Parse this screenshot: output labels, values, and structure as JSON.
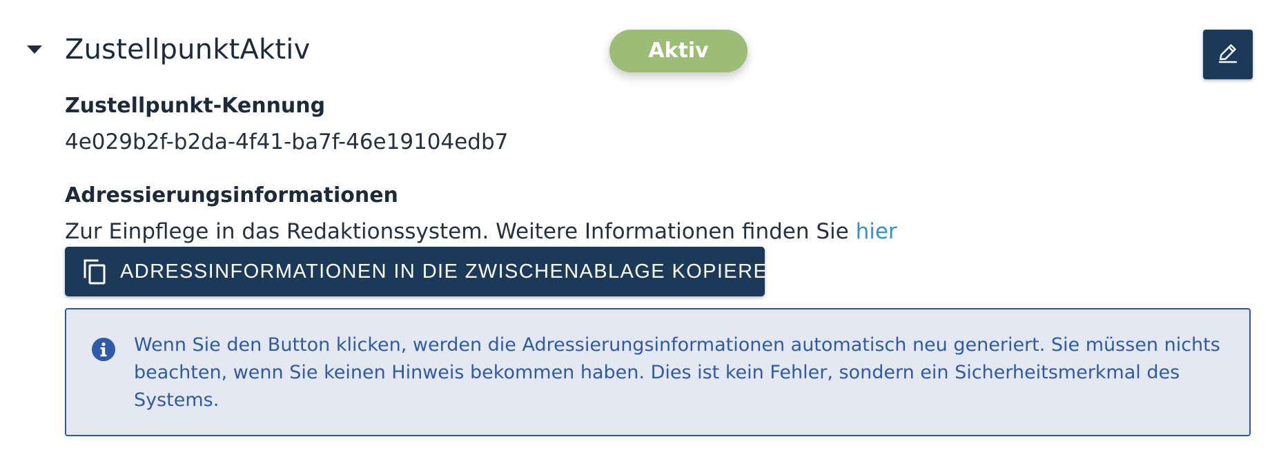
{
  "header": {
    "title": "ZustellpunktAktiv",
    "status": "Aktiv",
    "status_color": "#9bbd75",
    "expand_icon": "caret-down-icon",
    "edit_icon": "pencil-icon"
  },
  "kennung": {
    "label": "Zustellpunkt-Kennung",
    "value": "4e029b2f-b2da-4f41-ba7f-46e19104edb7"
  },
  "adressierung": {
    "label": "Adressierungsinformationen",
    "description": "Zur Einpflege in das Redaktionssystem. Weitere Informationen finden Sie ",
    "link_text": "hier",
    "copy_button_label": "ADRESSINFORMATIONEN IN DIE ZWISCHENABLAGE KOPIEREN",
    "copy_icon": "copy-icon"
  },
  "info": {
    "icon": "info-icon",
    "text": "Wenn Sie den Button klicken, werden die Adressierungsinformationen automatisch neu generiert. Sie müssen nichts beachten, wenn Sie keinen Hinweis bekommen haben. Dies ist kein Fehler, sondern ein Sicherheitsmerkmal des Systems."
  },
  "colors": {
    "primary": "#1b3a5a",
    "link": "#3a8fd0",
    "info_text": "#2f5aa6",
    "info_background": "#e4e8f3"
  }
}
